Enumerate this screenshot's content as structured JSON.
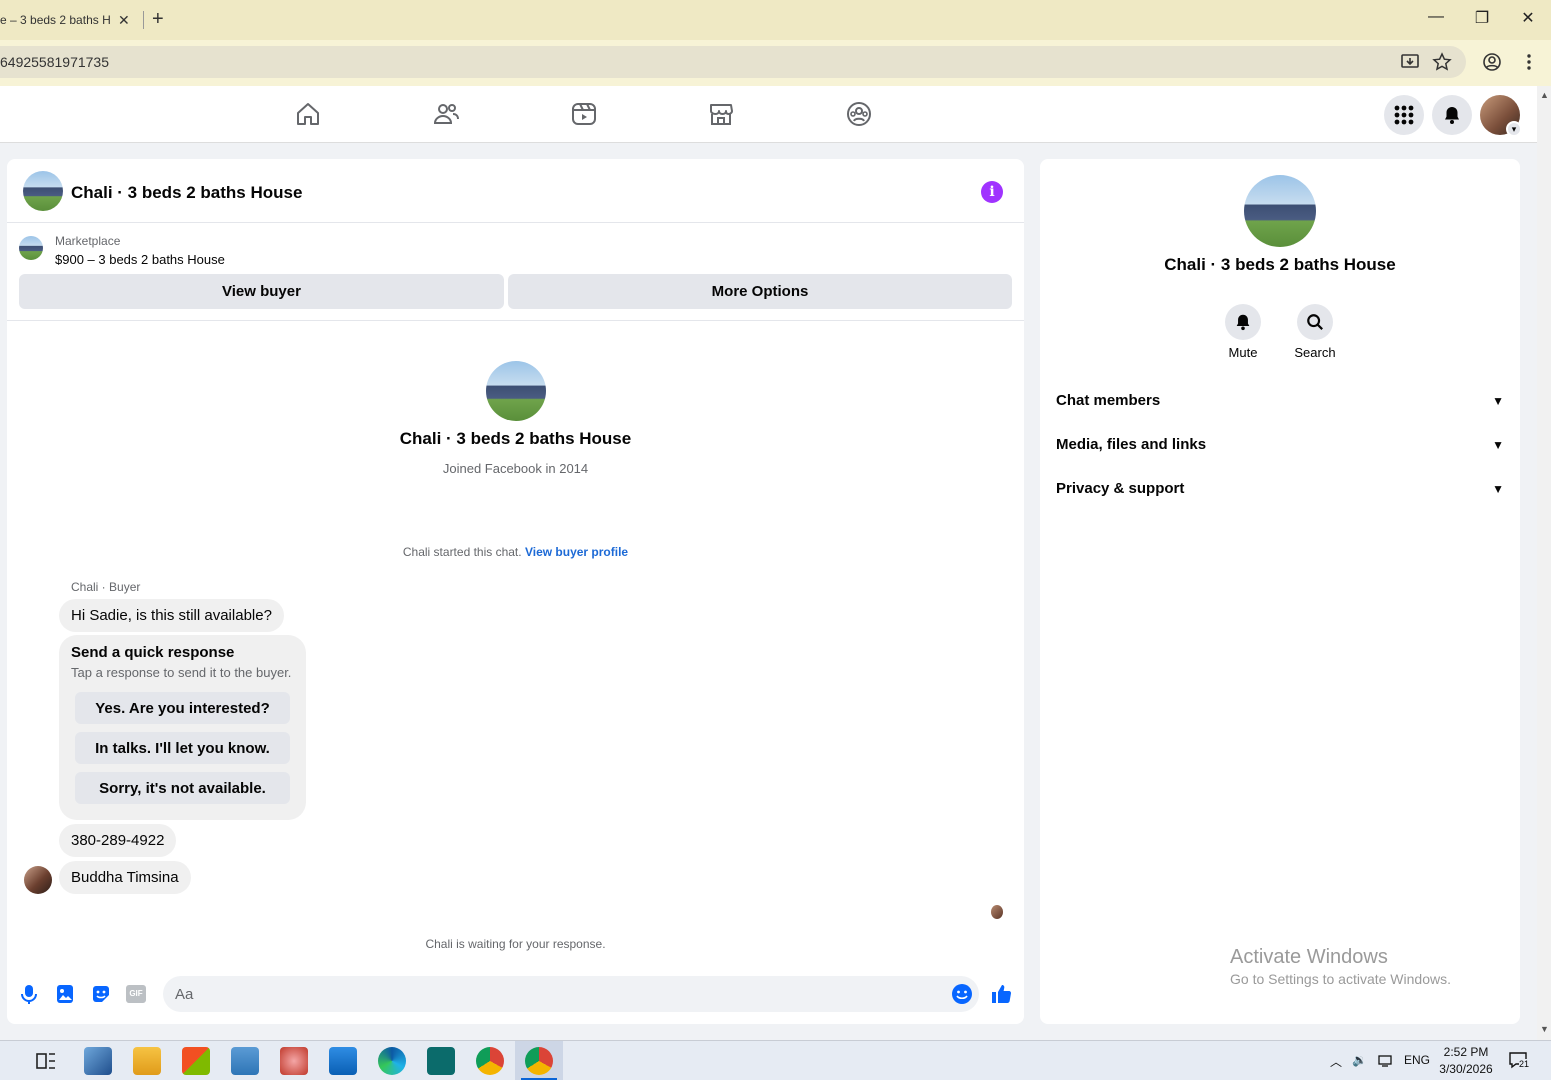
{
  "browser": {
    "tab_title": "e – 3 beds 2 baths H",
    "tab_close": "✕",
    "new_tab": "+",
    "url": "64925581971735",
    "win_minimize": "—",
    "win_restore": "❐",
    "win_close": "✕"
  },
  "chat": {
    "title": "Chali · 3 beds 2 baths House",
    "marketplace_label": "Marketplace",
    "listing": "$900 – 3 beds 2 baths House",
    "view_buyer": "View buyer",
    "more_options": "More Options",
    "profile_name": "Chali · 3 beds 2 baths House",
    "joined": "Joined Facebook in 2014",
    "started_text": "Chali started this chat.",
    "started_link": "View buyer profile",
    "sender": "Chali · Buyer",
    "messages": [
      "Hi Sadie, is this still available?",
      "380-289-4922",
      "Buddha Timsina"
    ],
    "quick": {
      "heading": "Send a quick response",
      "sub": "Tap a response to send it to the buyer.",
      "options": [
        "Yes. Are you interested?",
        "In talks. I'll let you know.",
        "Sorry, it's not available."
      ]
    },
    "waiting": "Chali is waiting for your response.",
    "input_placeholder": "Aa",
    "gif_label": "GIF"
  },
  "rpanel": {
    "name": "Chali · 3 beds 2 baths House",
    "mute": "Mute",
    "search": "Search",
    "sections": [
      "Chat members",
      "Media, files and links",
      "Privacy & support"
    ],
    "chevron": "⌄"
  },
  "watermark": {
    "line1": "Activate Windows",
    "line2": "Go to Settings to activate Windows."
  },
  "taskbar": {
    "lang": "ENG",
    "time": "2:52 PM",
    "date": "3/30/2026",
    "notif_count": "21"
  },
  "colors": {
    "accent": "#0866ff",
    "info": "#a033ff",
    "link": "#1d6ad6"
  }
}
